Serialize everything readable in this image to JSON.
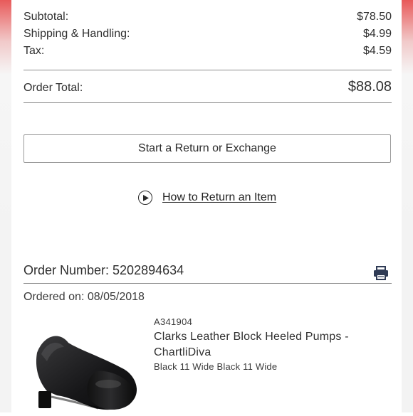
{
  "summary": {
    "subtotal_label": "Subtotal:",
    "subtotal_value": "$78.50",
    "shipping_label": "Shipping & Handling:",
    "shipping_value": "$4.99",
    "tax_label": "Tax:",
    "tax_value": "$4.59",
    "total_label": "Order Total:",
    "total_value": "$88.08"
  },
  "actions": {
    "return_button_label": "Start a Return or Exchange",
    "howto_link_label": "How to Return an Item"
  },
  "order": {
    "number_label": "Order Number: 5202894634",
    "ordered_on": "Ordered on: 08/05/2018"
  },
  "item": {
    "sku": "A341904",
    "name": "Clarks Leather Block Heeled Pumps - ChartliDiva",
    "variant": "Black 11 Wide Black 11 Wide"
  },
  "icons": {
    "play": "play-circle-icon",
    "print": "printer-icon"
  },
  "colors": {
    "text": "#2b2b2b",
    "rule": "#8c8c8c",
    "edge_accent": "#e85a5a"
  }
}
